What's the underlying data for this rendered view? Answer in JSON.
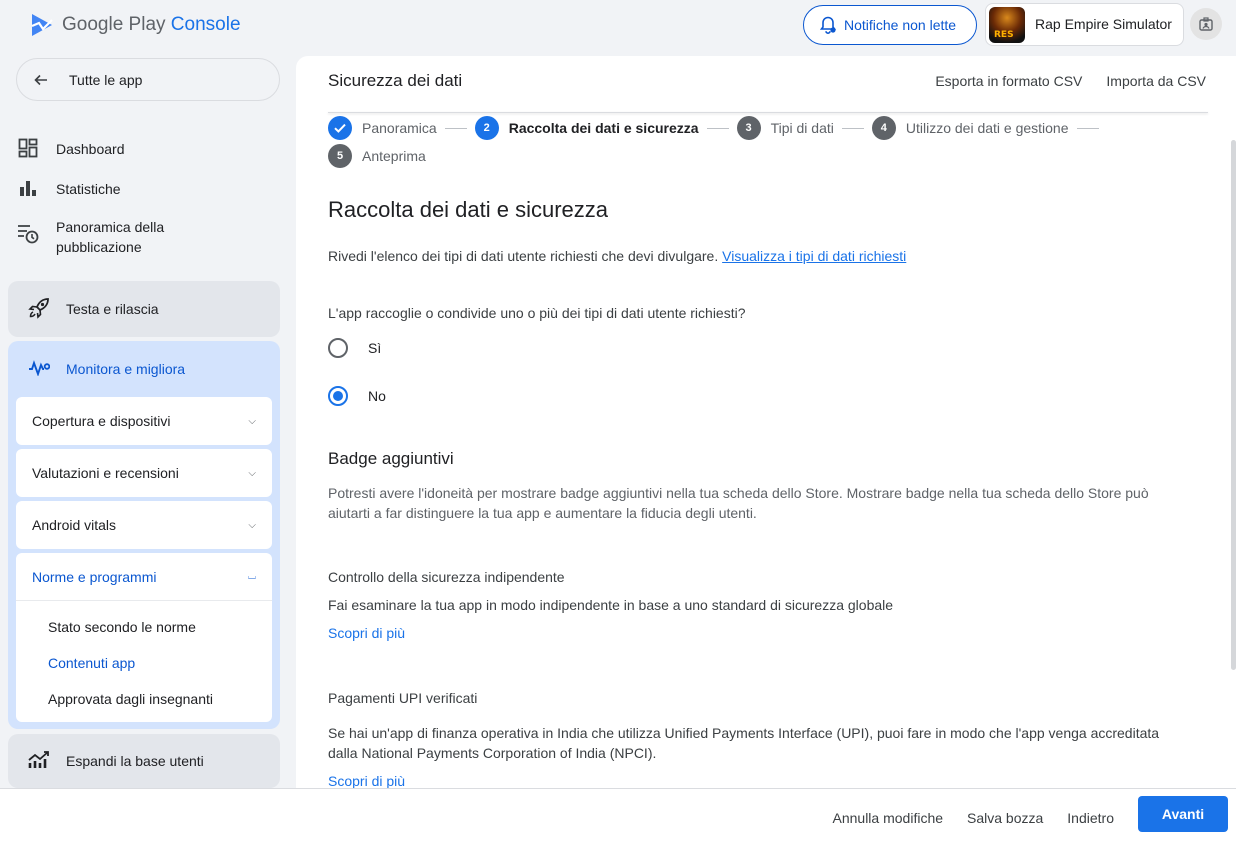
{
  "topbar": {
    "logo_google": "Google Play",
    "logo_console": "Console",
    "notifications_label": "Notifiche non lette",
    "app_name": "Rap Empire Simulator",
    "app_icon_text": "RES"
  },
  "sidebar": {
    "back_label": "Tutte le app",
    "items": [
      {
        "label": "Dashboard",
        "icon": "dashboard-icon"
      },
      {
        "label": "Statistiche",
        "icon": "bar-chart-icon"
      },
      {
        "label": "Panoramica della pubblicazione",
        "icon": "publishing-overview-icon"
      }
    ],
    "test_release_label": "Testa e rilascia",
    "monitor_label": "Monitora e migliora",
    "subsections": [
      {
        "label": "Copertura e dispositivi"
      },
      {
        "label": "Valutazioni e recensioni"
      },
      {
        "label": "Android vitals"
      }
    ],
    "policy": {
      "label": "Norme e programmi",
      "items": [
        "Stato secondo le norme",
        "Contenuti app",
        "Approvata dagli insegnanti"
      ],
      "active_index": 1
    },
    "grow_label": "Espandi la base utenti"
  },
  "main": {
    "title": "Sicurezza dei dati",
    "export_csv": "Esporta in formato CSV",
    "import_csv": "Importa da CSV",
    "steps": [
      {
        "num": "",
        "label": "Panoramica",
        "state": "done"
      },
      {
        "num": "2",
        "label": "Raccolta dei dati e sicurezza",
        "state": "current"
      },
      {
        "num": "3",
        "label": "Tipi di dati",
        "state": "pending"
      },
      {
        "num": "4",
        "label": "Utilizzo dei dati e gestione",
        "state": "pending"
      },
      {
        "num": "5",
        "label": "Anteprima",
        "state": "pending"
      }
    ],
    "heading": "Raccolta dei dati e sicurezza",
    "intro_text": "Rivedi l'elenco dei tipi di dati utente richiesti che devi divulgare.",
    "intro_link": "Visualizza i tipi di dati richiesti",
    "question": "L'app raccoglie o condivide uno o più dei tipi di dati utente richiesti?",
    "option_yes": "Sì",
    "option_no": "No",
    "selected_option": "No",
    "badges_heading": "Badge aggiuntivi",
    "badges_text": "Potresti avere l'idoneità per mostrare badge aggiuntivi nella tua scheda dello Store. Mostrare badge nella tua scheda dello Store può aiutarti a far distinguere la tua app e aumentare la fiducia degli utenti.",
    "security_title": "Controllo della sicurezza indipendente",
    "security_text": "Fai esaminare la tua app in modo indipendente in base a uno standard di sicurezza globale",
    "learn_more": "Scopri di più",
    "upi_title": "Pagamenti UPI verificati",
    "upi_text": "Se hai un'app di finanza operativa in India che utilizza Unified Payments Interface (UPI), puoi fare in modo che l'app venga accreditata dalla National Payments Corporation of India (NPCI).",
    "learn_more_2": "Scopri di più"
  },
  "bottom": {
    "discard": "Annulla modifiche",
    "save_draft": "Salva bozza",
    "back": "Indietro",
    "next": "Avanti"
  },
  "colors": {
    "accent": "#1a73e8",
    "sidebar_active_bg": "#d3e3fd"
  }
}
